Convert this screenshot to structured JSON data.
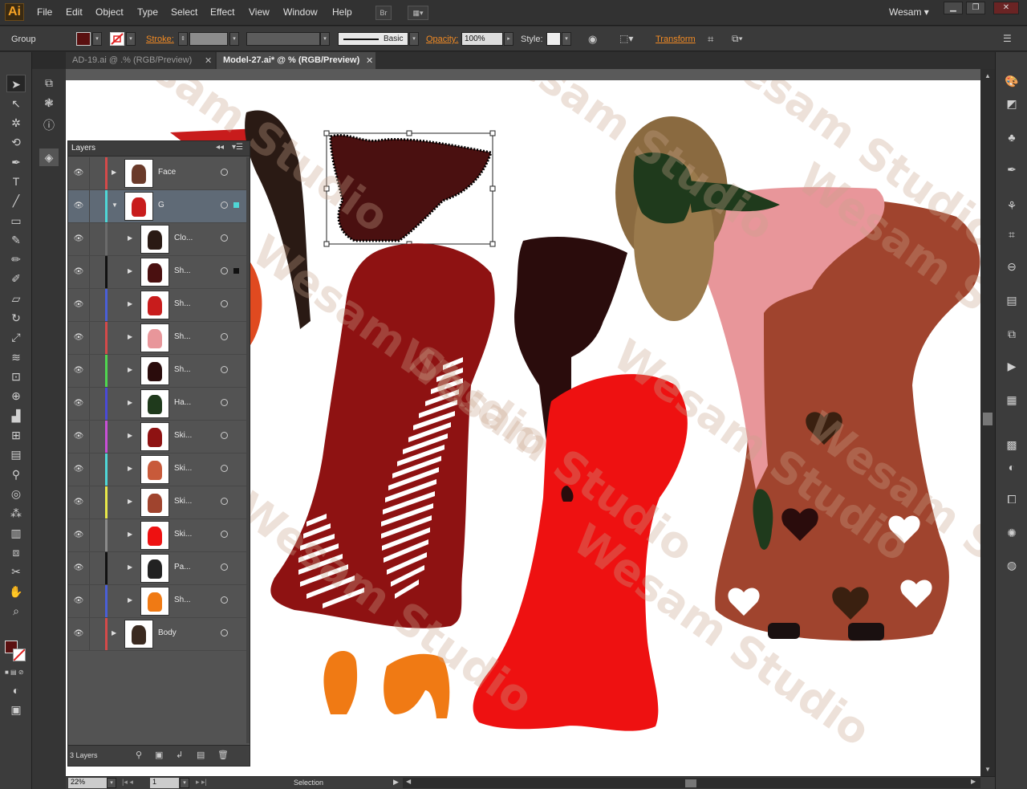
{
  "app": {
    "logo": "Ai",
    "workspace": "Wesam"
  },
  "menu": [
    "File",
    "Edit",
    "Object",
    "Type",
    "Select",
    "Effect",
    "View",
    "Window",
    "Help"
  ],
  "bridge_label": "Br",
  "control": {
    "selection_type": "Group",
    "stroke_label": "Stroke:",
    "brush_label": "Basic",
    "opacity_label": "Opacity:",
    "opacity_value": "100%",
    "style_label": "Style:",
    "transform_label": "Transform"
  },
  "tabs": [
    {
      "label": "AD-19.ai @ .% (RGB/Preview)"
    },
    {
      "label": "Model-27.ai* @ % (RGB/Preview)"
    }
  ],
  "layers_panel": {
    "title": "Layers",
    "layers": [
      {
        "name": "Face",
        "color": "#d44a4a",
        "indent": 0,
        "selected": false
      },
      {
        "name": "G",
        "color": "#4fd6d6",
        "indent": 0,
        "selected": true
      },
      {
        "name": "Clo...",
        "color": "#6b6b6b",
        "indent": 1,
        "selected": false
      },
      {
        "name": "Sh...",
        "color": "#111111",
        "indent": 1,
        "selected": false
      },
      {
        "name": "Sh...",
        "color": "#4a5fd6",
        "indent": 1,
        "selected": false
      },
      {
        "name": "Sh...",
        "color": "#d44a4a",
        "indent": 1,
        "selected": false
      },
      {
        "name": "Sh...",
        "color": "#4fd64f",
        "indent": 1,
        "selected": false
      },
      {
        "name": "Ha...",
        "color": "#4a4ad6",
        "indent": 1,
        "selected": false
      },
      {
        "name": "Ski...",
        "color": "#c84fd6",
        "indent": 1,
        "selected": false
      },
      {
        "name": "Ski...",
        "color": "#4fd6d6",
        "indent": 1,
        "selected": false
      },
      {
        "name": "Ski...",
        "color": "#e8e84a",
        "indent": 1,
        "selected": false
      },
      {
        "name": "Ski...",
        "color": "#8a8a8a",
        "indent": 1,
        "selected": false
      },
      {
        "name": "Pa...",
        "color": "#111111",
        "indent": 1,
        "selected": false
      },
      {
        "name": "Sh...",
        "color": "#4a5fd6",
        "indent": 1,
        "selected": false
      },
      {
        "name": "Body",
        "color": "#d44a4a",
        "indent": 0,
        "selected": false
      }
    ],
    "footer_count": "3 Layers"
  },
  "status": {
    "zoom": "22%",
    "page": "1",
    "tool": "Selection"
  },
  "watermark": "Wesam Studio",
  "colors": {
    "fill_swatch": "#5a1010",
    "accent": "#f08a24"
  }
}
